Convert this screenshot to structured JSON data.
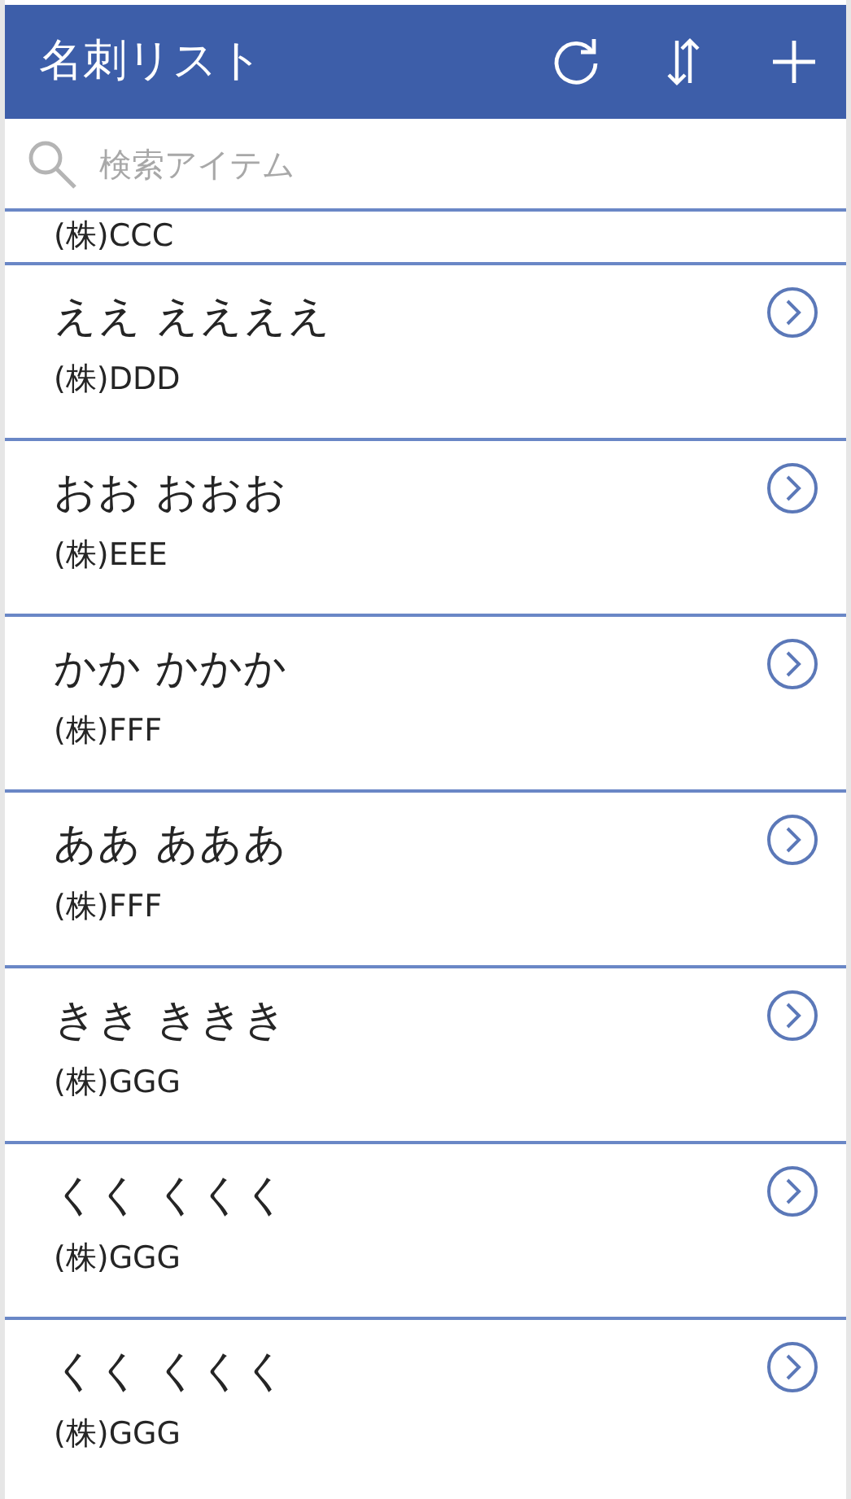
{
  "header": {
    "title": "名刺リスト"
  },
  "search": {
    "placeholder": "検索アイテム"
  },
  "partial_row": {
    "company": "(株)CCC"
  },
  "cards": [
    {
      "name": "ええ ええええ",
      "company": "(株)DDD"
    },
    {
      "name": "おお おおお",
      "company": "(株)EEE"
    },
    {
      "name": "かか かかか",
      "company": "(株)FFF"
    },
    {
      "name": "ああ あああ",
      "company": "(株)FFF"
    },
    {
      "name": "きき ききき",
      "company": "(株)GGG"
    },
    {
      "name": "くく くくく",
      "company": "(株)GGG"
    },
    {
      "name": "くく くくく",
      "company": "(株)GGG"
    }
  ]
}
